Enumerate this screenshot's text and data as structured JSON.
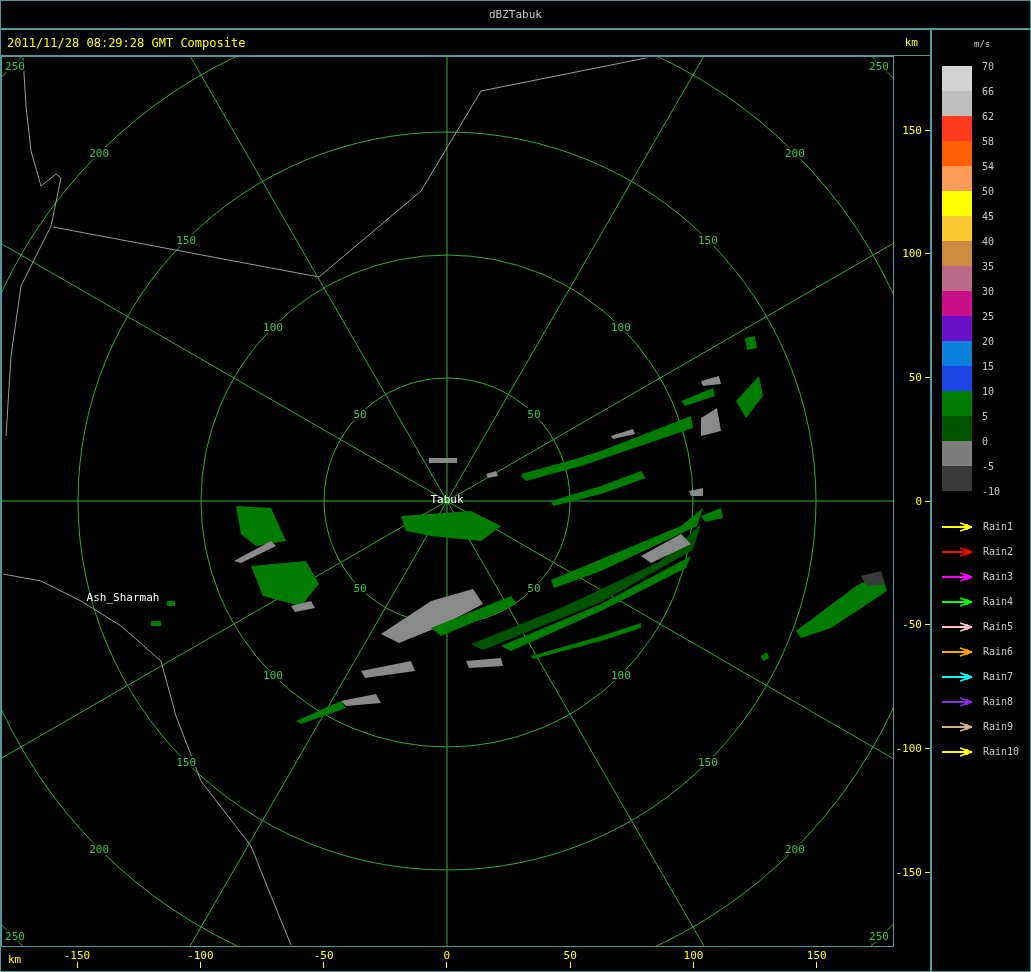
{
  "window": {
    "title": "dBZTabuk"
  },
  "header": {
    "timestamp": "2011/11/28 08:29:28 GMT Composite",
    "unit": "km"
  },
  "plot": {
    "rings": [
      {
        "labels": [
          "50",
          "50",
          "50",
          "50"
        ]
      },
      {
        "labels": [
          "100",
          "100",
          "100",
          "100"
        ]
      },
      {
        "labels": [
          "150",
          "150",
          "150",
          "150"
        ]
      },
      {
        "labels": [
          "200",
          "200",
          "200",
          "200"
        ]
      },
      {
        "labels": [
          "250",
          "250",
          "250",
          "250"
        ]
      }
    ],
    "places": [
      {
        "name": "Tabuk"
      },
      {
        "name": "Ash_Sharmah"
      }
    ]
  },
  "y_axis": {
    "ticks": [
      "150",
      "100",
      "50",
      "0",
      "-50",
      "-100",
      "-150"
    ]
  },
  "x_axis": {
    "unit": "km",
    "ticks": [
      "-150",
      "-100",
      "-50",
      "0",
      "50",
      "100",
      "150"
    ]
  },
  "legend": {
    "unit": "m/s",
    "bins": [
      {
        "color": "#d3d3d3"
      },
      {
        "color": "#bebebe"
      },
      {
        "color": "#ff3a1e"
      },
      {
        "color": "#ff5f00"
      },
      {
        "color": "#ff9b5a"
      },
      {
        "color": "#ffff00"
      },
      {
        "color": "#fcc832"
      },
      {
        "color": "#d08a3f"
      },
      {
        "color": "#bc6a8a"
      },
      {
        "color": "#c8108a"
      },
      {
        "color": "#6a10c8"
      },
      {
        "color": "#0a82dc"
      },
      {
        "color": "#1e46e6"
      },
      {
        "color": "#007d00"
      },
      {
        "color": "#005400"
      },
      {
        "color": "#7d7d7d"
      },
      {
        "color": "#3a3a3a"
      }
    ],
    "ticks": [
      "70",
      "66",
      "62",
      "58",
      "54",
      "50",
      "45",
      "40",
      "35",
      "30",
      "25",
      "20",
      "15",
      "10",
      "5",
      "0",
      "-5",
      "-10"
    ]
  },
  "series_legend": [
    {
      "label": "Rain1",
      "color": "#ffff00"
    },
    {
      "label": "Rain2",
      "color": "#ff0000"
    },
    {
      "label": "Rain3",
      "color": "#ff00ff"
    },
    {
      "label": "Rain4",
      "color": "#00ff00"
    },
    {
      "label": "Rain5",
      "color": "#ffc0cb"
    },
    {
      "label": "Rain6",
      "color": "#ffa500"
    },
    {
      "label": "Rain7",
      "color": "#00ffff"
    },
    {
      "label": "Rain8",
      "color": "#8a2be2"
    },
    {
      "label": "Rain9",
      "color": "#d2b48c"
    },
    {
      "label": "Rain10",
      "color": "#ffff00"
    }
  ]
}
